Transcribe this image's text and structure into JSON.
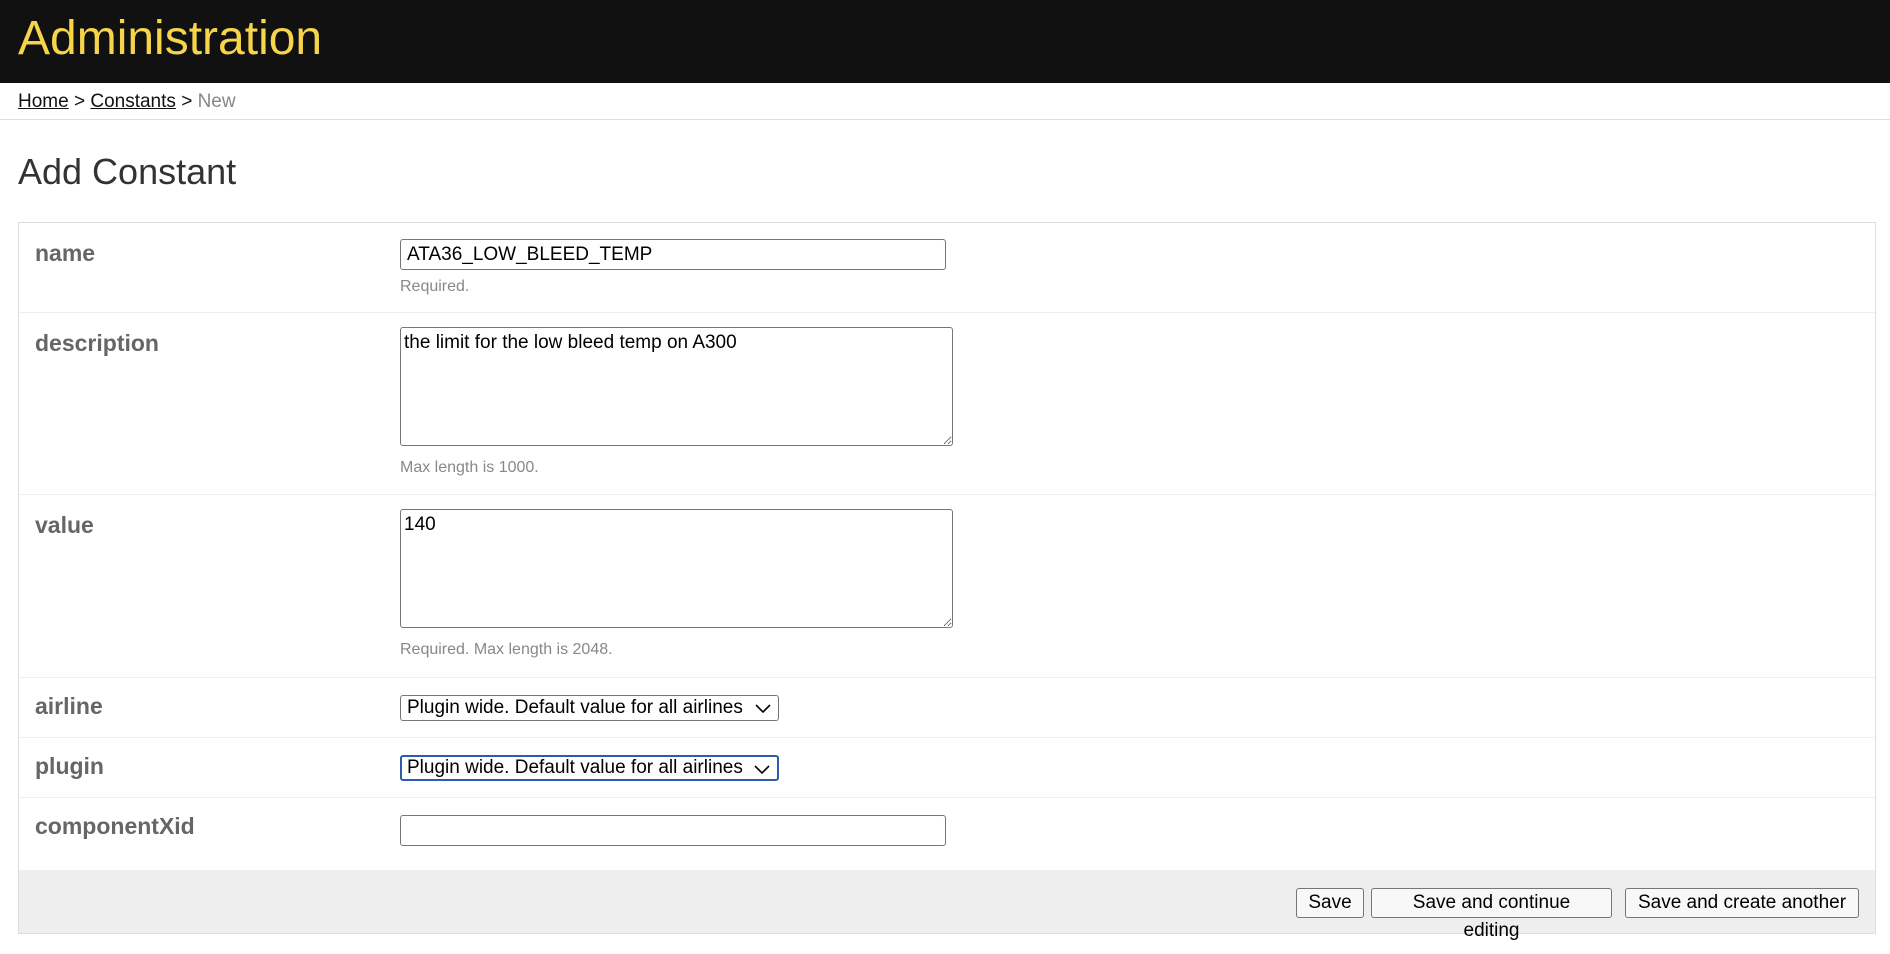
{
  "header": {
    "title": "Administration"
  },
  "breadcrumbs": {
    "home": "Home",
    "separator": ">",
    "section": "Constants",
    "current": "New"
  },
  "page": {
    "title": "Add Constant"
  },
  "form": {
    "name": {
      "label": "name",
      "value": "ATA36_LOW_BLEED_TEMP",
      "help": "Required."
    },
    "description": {
      "label": "description",
      "value": "the limit for the low bleed temp on A300",
      "help": "Max length is 1000."
    },
    "value": {
      "label": "value",
      "value": "140",
      "help": "Required. Max length is 2048."
    },
    "airline": {
      "label": "airline",
      "selected": "Plugin wide. Default value for all airlines"
    },
    "plugin": {
      "label": "plugin",
      "selected": "Plugin wide. Default value for all airlines"
    },
    "componentXid": {
      "label": "componentXid",
      "value": ""
    }
  },
  "actions": {
    "save": "Save",
    "save_continue": "Save and continue editing",
    "save_another": "Save and create another"
  },
  "colors": {
    "header_bg": "#111111",
    "header_title": "#f6d54a",
    "focus_border": "#2a5db0"
  }
}
